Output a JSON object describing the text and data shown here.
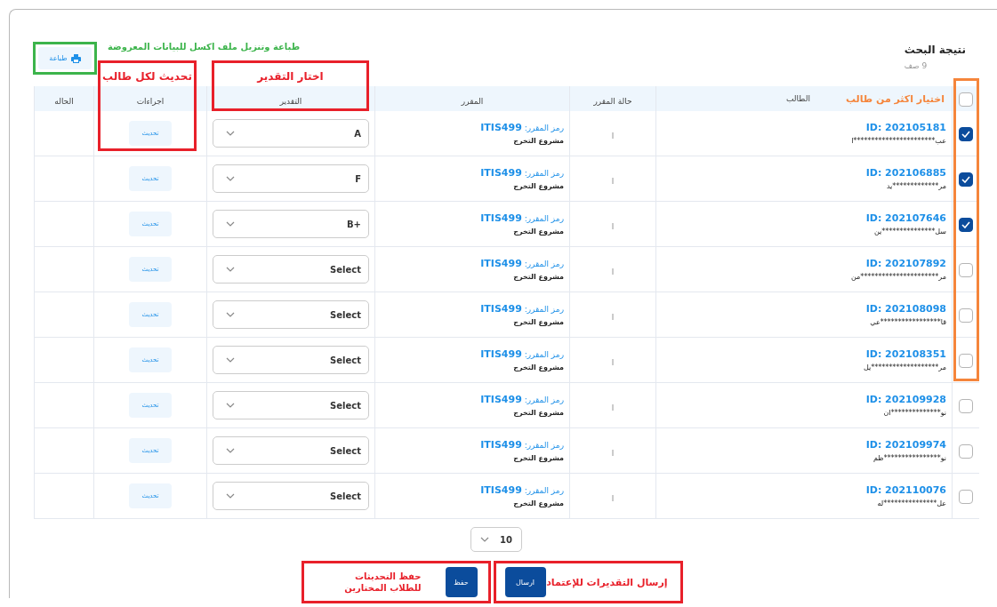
{
  "title": "نتيجة البحث",
  "row_count": "9 صف",
  "print_button": "طباعة",
  "header_checkbox": {
    "checked": false
  },
  "columns": [
    "الطالب",
    "حالة المقرر",
    "المقرر",
    "التقدير",
    "اجراءات",
    "الحاله"
  ],
  "rows": [
    {
      "checked": true,
      "id": "ID: 202105181",
      "name": "عب***********************ا",
      "course_code": "رمز المقرر: **ITIS499**",
      "course_name": "مشروع التخرج",
      "status": "ا",
      "grade": "A",
      "action": "تحديث"
    },
    {
      "checked": true,
      "id": "ID: 202106885",
      "name": "مر*************يد",
      "course_code": "رمز المقرر: **ITIS499**",
      "course_name": "مشروع التخرج",
      "status": "ا",
      "grade": "F",
      "action": "تحديث"
    },
    {
      "checked": true,
      "id": "ID: 202107646",
      "name": "سل***************ين",
      "course_code": "رمز المقرر: **ITIS499**",
      "course_name": "مشروع التخرج",
      "status": "ا",
      "grade": "+B",
      "action": "تحديث"
    },
    {
      "checked": false,
      "id": "ID: 202107892",
      "name": "مر**********************من",
      "course_code": "رمز المقرر: **ITIS499**",
      "course_name": "مشروع التخرج",
      "status": "ا",
      "grade": "Select",
      "action": "تحديث"
    },
    {
      "checked": false,
      "id": "ID: 202108098",
      "name": "قا*****************عي",
      "course_code": "رمز المقرر: **ITIS499**",
      "course_name": "مشروع التخرج",
      "status": "ا",
      "grade": "Select",
      "action": "تحديث"
    },
    {
      "checked": false,
      "id": "ID: 202108351",
      "name": "مر*******************يل",
      "course_code": "رمز المقرر: **ITIS499**",
      "course_name": "مشروع التخرج",
      "status": "ا",
      "grade": "Select",
      "action": "تحديث"
    },
    {
      "checked": false,
      "id": "ID: 202109928",
      "name": "نو**************ان",
      "course_code": "رمز المقرر: **ITIS499**",
      "course_name": "مشروع التخرج",
      "status": "ا",
      "grade": "Select",
      "action": "تحديث"
    },
    {
      "checked": false,
      "id": "ID: 202109974",
      "name": "نو****************ظم",
      "course_code": "رمز المقرر: **ITIS499**",
      "course_name": "مشروع التخرج",
      "status": "ا",
      "grade": "Select",
      "action": "تحديث"
    },
    {
      "checked": false,
      "id": "ID: 202110076",
      "name": "عل***************له",
      "course_code": "رمز المقرر: **ITIS499**",
      "course_name": "مشروع التخرج",
      "status": "ا",
      "grade": "Select",
      "action": "تحديث"
    }
  ],
  "page_size": "10",
  "send_button": "ارسال",
  "save_button": "حفظ",
  "annotations": [
    {
      "text": "طباعة وتنزيل ملف اكسل  للبيانات المعروضة",
      "color": "#3cb44b"
    },
    {
      "text": "اختار التقدير",
      "color": "#e8202a"
    },
    {
      "text": "تحديث لكل طالب",
      "color": "#e8202a"
    },
    {
      "text": "اختيار اكثر من طالب",
      "color": "#f5853b"
    },
    {
      "text": "إرسال التقديرات للإعتماد",
      "color": "#e8202a"
    },
    {
      "text": "حفظ التحديثات للطلاب المختارين",
      "color": "#e8202a"
    }
  ]
}
